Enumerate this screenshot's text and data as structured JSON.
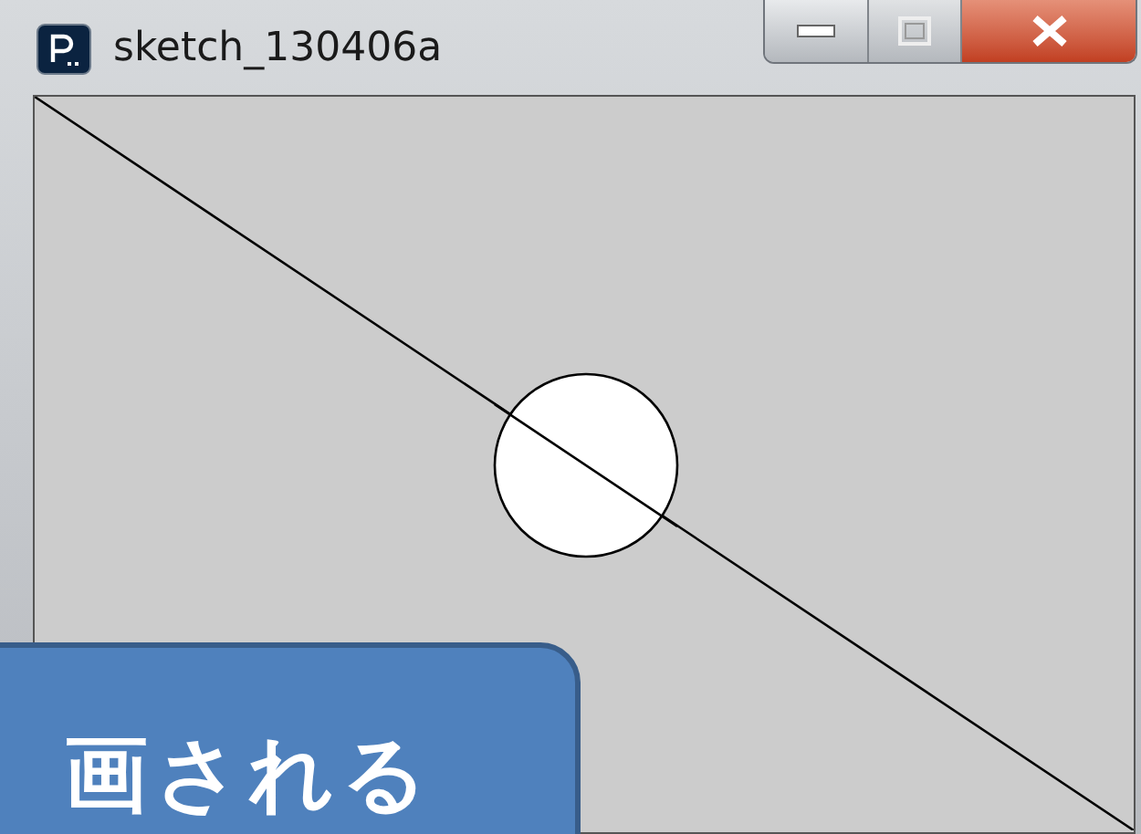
{
  "window": {
    "title": "sketch_130406a"
  },
  "callout": {
    "text": "画される"
  }
}
